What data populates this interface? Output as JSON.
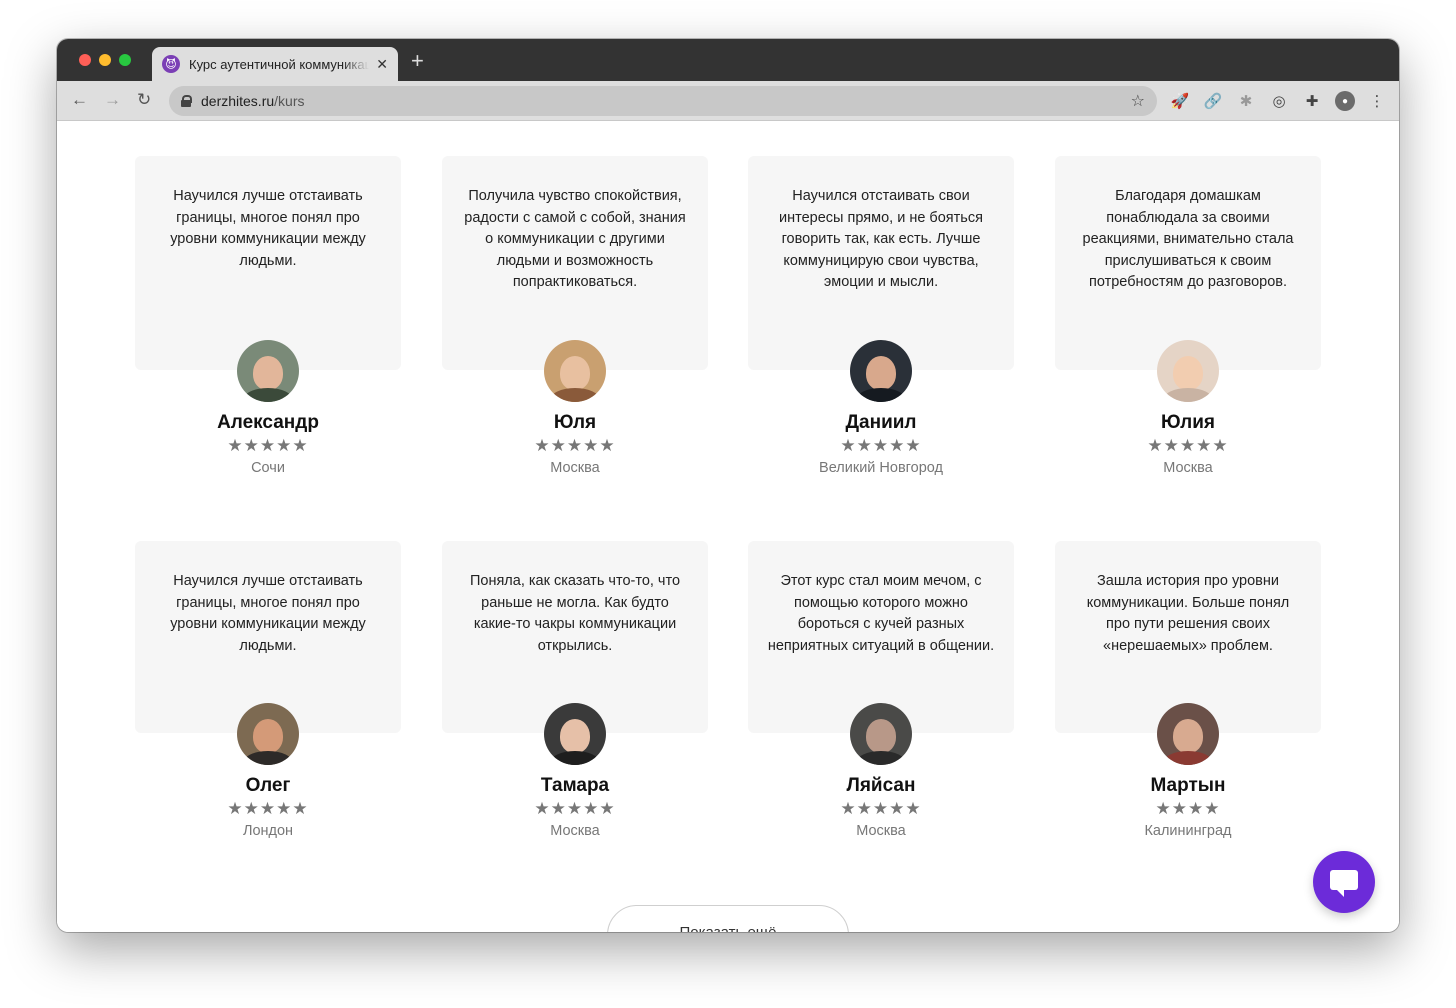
{
  "browser": {
    "tab_title": "Курс аутентичной коммуникации",
    "tab_favicon": "purple-devil-icon",
    "new_tab": "+",
    "close_tab": "✕",
    "url_domain": "derzhites.ru",
    "url_path": "/kurs",
    "colors": {
      "tabbar": "#333333",
      "toolbar": "#dedede"
    }
  },
  "reviews": [
    {
      "text": "Научился лучше отстаивать границы, многое понял про уровни коммуникации между людьми.",
      "name": "Александр",
      "stars": "★★★★★",
      "city": "Сочи"
    },
    {
      "text": "Получила чувство спокойствия, радости с самой с собой, знания о коммуникации с другими людьми и возможность попрактиковаться.",
      "name": "Юля",
      "stars": "★★★★★",
      "city": "Москва"
    },
    {
      "text": "Научился отстаивать свои интересы прямо, и не бояться говорить так, как есть. Лучше коммуницирую свои чувства, эмоции и мысли.",
      "name": "Даниил",
      "stars": "★★★★★",
      "city": "Великий Новгород"
    },
    {
      "text": "Благодаря домашкам понаблюдала за своими реакциями, внимательно стала прислушиваться к своим потребностям до разговоров.",
      "name": "Юлия",
      "stars": "★★★★★",
      "city": "Москва"
    },
    {
      "text": "Научился лучше отстаивать границы, многое понял про уровни коммуникации между людьми.",
      "name": "Олег",
      "stars": "★★★★★",
      "city": "Лондон"
    },
    {
      "text": "Поняла, как сказать что-то, что раньше не могла. Как будто какие-то чакры коммуникации открылись.",
      "name": "Тамара",
      "stars": "★★★★★",
      "city": "Москва"
    },
    {
      "text": "Этот курс стал моим мечом, с помощью которого можно бороться с кучей разных неприятных ситуаций в общении.",
      "name": "Ляйсан",
      "stars": "★★★★★",
      "city": "Москва"
    },
    {
      "text": "Зашла история про уровни коммуникации. Больше понял про пути решения своих «нерешаемых» проблем.",
      "name": "Мартын",
      "stars": "★★★★",
      "city": "Калининград"
    }
  ],
  "more_button": "Показать ещё",
  "accent_color": "#6c2bd9"
}
